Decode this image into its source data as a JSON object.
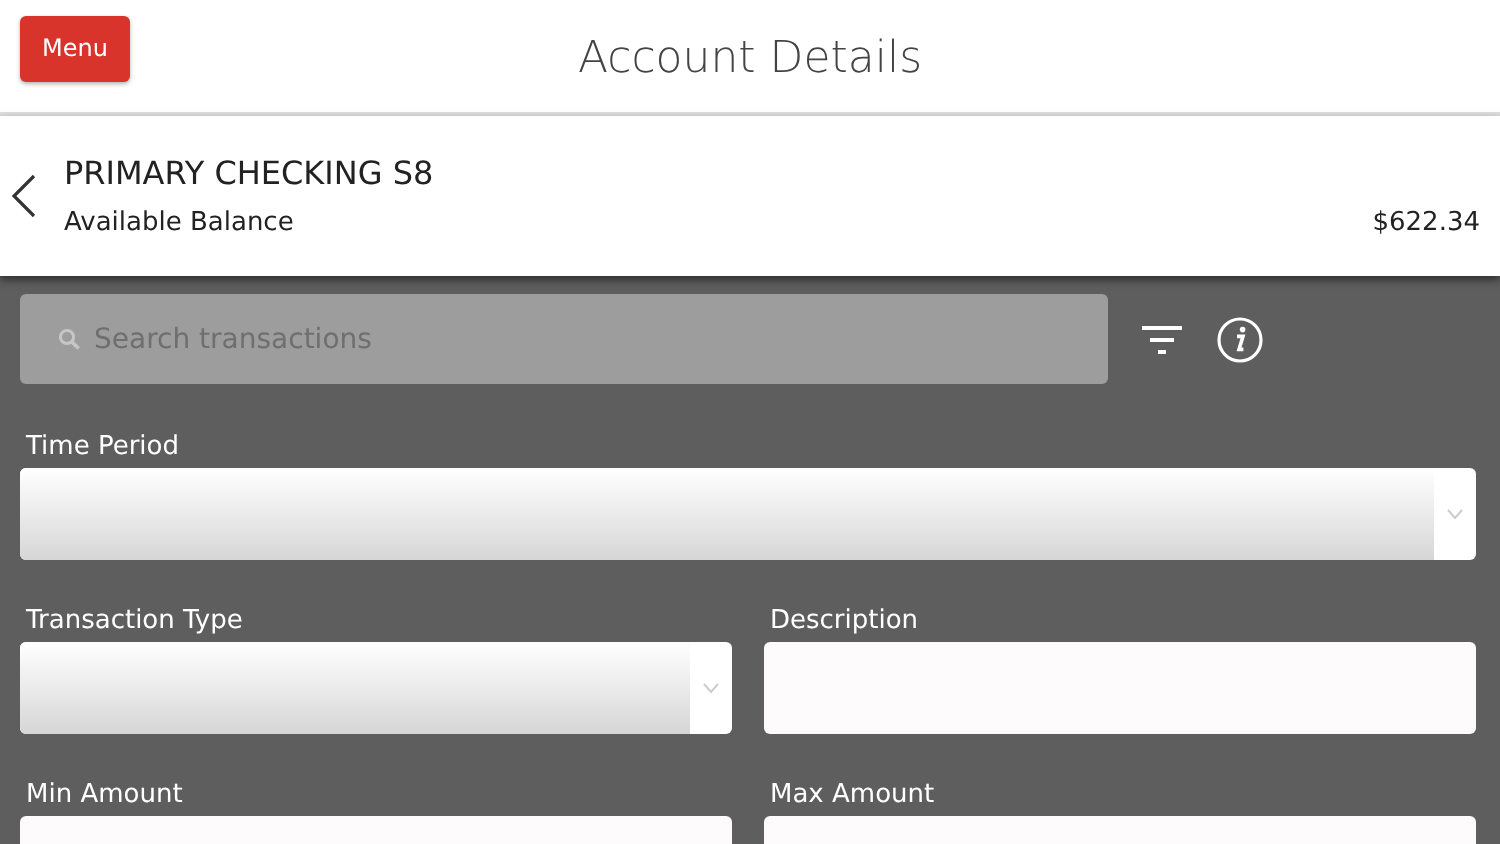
{
  "header": {
    "menu_button": "Menu",
    "title": "Account Details"
  },
  "account": {
    "name": "PRIMARY CHECKING S8",
    "balance_label": "Available Balance",
    "balance": "$622.34"
  },
  "search": {
    "placeholder": "Search transactions"
  },
  "filter_rows": [
    {
      "fields": [
        {
          "label": "Time Period",
          "kind": "select"
        }
      ]
    },
    {
      "fields": [
        {
          "label": "Transaction Type",
          "kind": "select"
        },
        {
          "label": "Description",
          "kind": "text"
        }
      ]
    },
    {
      "fields": [
        {
          "label": "Min Amount",
          "kind": "text"
        },
        {
          "label": "Max Amount",
          "kind": "text"
        }
      ]
    }
  ]
}
